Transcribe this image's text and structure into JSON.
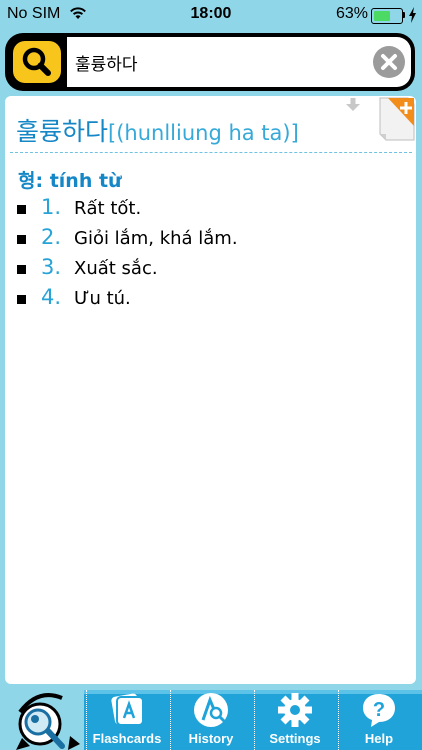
{
  "status_bar": {
    "carrier": "No SIM",
    "time": "18:00",
    "battery_percent": "63%",
    "battery_level": 0.63
  },
  "search": {
    "value": "훌륭하다"
  },
  "entry": {
    "headword": "훌륭하다",
    "pronunciation": "[(hunlliung ha ta)]",
    "part_of_speech": "형: tính từ",
    "definitions": [
      {
        "num": "1.",
        "text": "Rất tốt."
      },
      {
        "num": "2.",
        "text": "Giỏi lắm, khá lắm."
      },
      {
        "num": "3.",
        "text": "Xuất sắc."
      },
      {
        "num": "4.",
        "text": "Ưu tú."
      }
    ]
  },
  "toolbar": {
    "tabs": [
      {
        "label": "Flashcards",
        "icon": "flashcards-icon"
      },
      {
        "label": "History",
        "icon": "history-icon"
      },
      {
        "label": "Settings",
        "icon": "gear-icon"
      },
      {
        "label": "Help",
        "icon": "help-icon"
      }
    ]
  },
  "colors": {
    "background": "#8fd6e8",
    "accent_blue": "#1687c6",
    "search_yellow": "#f7c51c",
    "toolbar_blue": "#1fa3d8"
  }
}
